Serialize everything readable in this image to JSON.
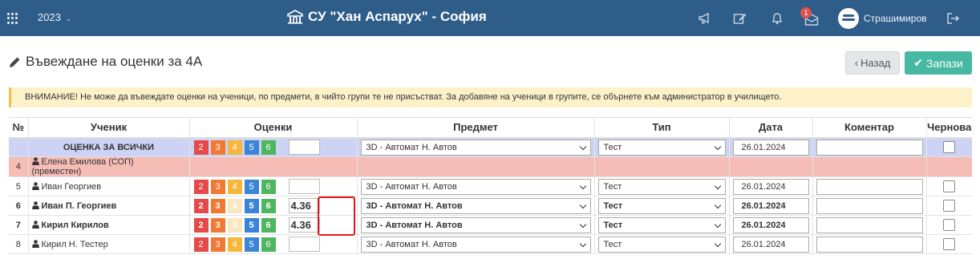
{
  "topbar": {
    "year": "2023",
    "school_name": "СУ \"Хан Аспарух\" - София",
    "notification_count": "1",
    "username": "Страшимиров"
  },
  "page": {
    "title": "Въвеждане на оценки за 4А",
    "back_label": "Назад",
    "save_label": "Запази"
  },
  "alert": "ВНИМАНИЕ! Не може да въвеждате оценки на ученици, по предмети, в чийто групи те не присъстват. За добавяне на ученици в групите, се обърнете към администратор в училището.",
  "table": {
    "headers": [
      "№",
      "Ученик",
      "Оценки",
      "Предмет",
      "Тип",
      "Дата",
      "Коментар",
      "Чернова"
    ],
    "grade_buttons": [
      "2",
      "3",
      "4",
      "5",
      "6"
    ],
    "all_row": {
      "label": "ОЦЕНКА ЗА ВСИЧКИ",
      "grade": "",
      "subject": "3D - Автомат Н. Автов",
      "type": "Тест",
      "date": "26.01.2024"
    },
    "rows": [
      {
        "num": "4",
        "name": "Елена Емилова (СОП) (преместен)"
      },
      {
        "num": "5",
        "name": "Иван Георгиев",
        "grade": "",
        "subject": "3D - Автомат Н. Автов",
        "type": "Тест",
        "date": "26.01.2024"
      },
      {
        "num": "6",
        "name": "Иван П. Георгиев",
        "grade": "4.36",
        "subject": "3D - Автомат Н. Автов",
        "type": "Тест",
        "date": "26.01.2024"
      },
      {
        "num": "7",
        "name": "Кирил Кирилов",
        "grade": "4.36",
        "subject": "3D - Автомат Н. Автов",
        "type": "Тест",
        "date": "26.01.2024"
      },
      {
        "num": "8",
        "name": "Кирил Н. Тестер",
        "grade": "",
        "subject": "3D - Автомат Н. Автов",
        "type": "Тест",
        "date": "26.01.2024"
      }
    ]
  },
  "colors": {
    "topbar": "#2f5d8a",
    "save_button": "#47b8a2",
    "grade_2": "#e54a4a",
    "grade_3": "#f07a33",
    "grade_4": "#f5b83c",
    "grade_5": "#3a86d4",
    "grade_6": "#4eb65e",
    "all_row": "#cdd3f4",
    "moved_row": "#f6bdb7",
    "highlight": "#e0161c"
  },
  "icons": [
    "apps-grid-icon",
    "chevron-down-icon",
    "school-icon",
    "megaphone-icon",
    "edit-icon",
    "bell-icon",
    "envelope-icon",
    "logout-icon",
    "pencil-icon",
    "chevron-left-icon",
    "check-icon",
    "student-icon"
  ]
}
